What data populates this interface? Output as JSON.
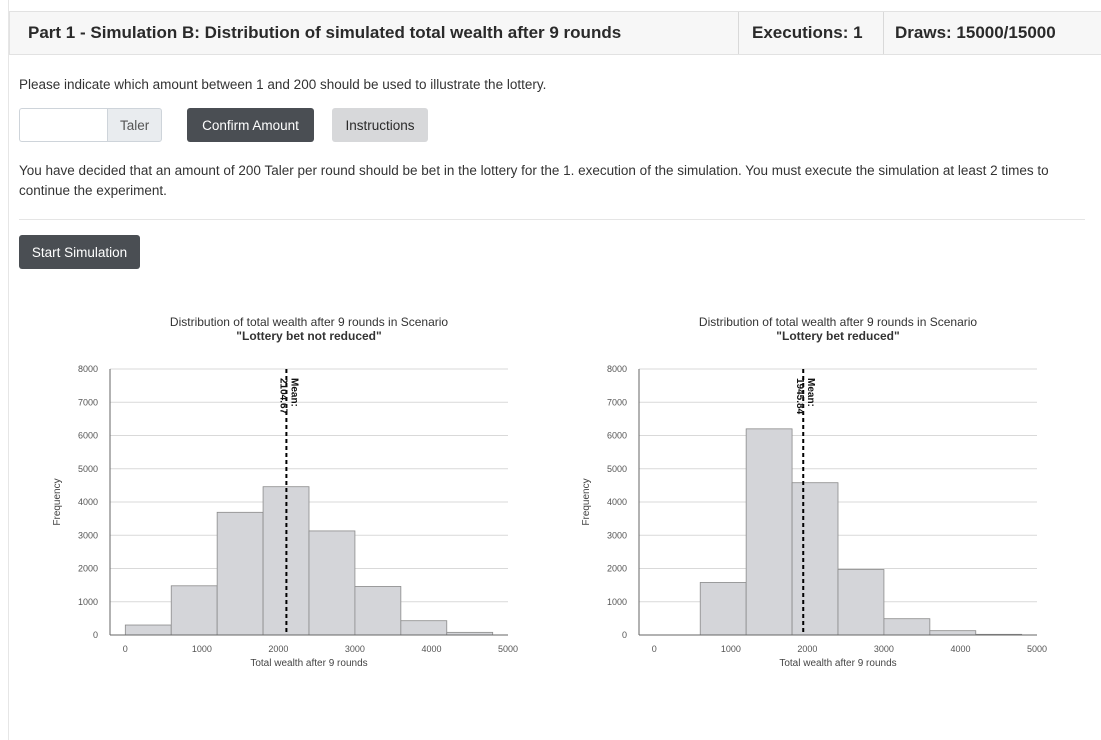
{
  "header": {
    "title": "Part 1 - Simulation B: Distribution of simulated total wealth after 9 rounds",
    "executions": "Executions: 1",
    "draws": "Draws: 15000/15000"
  },
  "form": {
    "prompt": "Please indicate which amount between 1 and 200 should be used to illustrate the lottery.",
    "amount_value": "",
    "amount_unit": "Taler",
    "confirm_label": "Confirm Amount",
    "instructions_label": "Instructions"
  },
  "info_text": "You have decided that an amount of 200 Taler per round should be bet in the lottery for the 1. execution of the simulation. You must execute the simulation at least 2 times to continue the experiment.",
  "start_label": "Start Simulation",
  "colors": {
    "bar_fill": "#d4d5d9",
    "bar_stroke": "#8a8a8a",
    "button_dark": "#4a4e53",
    "button_light": "#d7d8da"
  },
  "chart_data": [
    {
      "type": "bar",
      "title": "Distribution of total wealth after 9 rounds in Scenario",
      "subtitle": "\"Lottery bet not reduced\"",
      "xlabel": "Total wealth after 9 rounds",
      "ylabel": "Frequency",
      "xlim": [
        -200,
        5000
      ],
      "ylim": [
        0,
        8000
      ],
      "xticks": [
        0,
        1000,
        2000,
        3000,
        4000,
        5000
      ],
      "yticks": [
        0,
        1000,
        2000,
        3000,
        4000,
        5000,
        6000,
        7000,
        8000
      ],
      "bins": [
        {
          "x0": 0,
          "x1": 600,
          "count": 300
        },
        {
          "x0": 600,
          "x1": 1200,
          "count": 1480
        },
        {
          "x0": 1200,
          "x1": 1800,
          "count": 3690
        },
        {
          "x0": 1800,
          "x1": 2400,
          "count": 4460
        },
        {
          "x0": 2400,
          "x1": 3000,
          "count": 3130
        },
        {
          "x0": 3000,
          "x1": 3600,
          "count": 1460
        },
        {
          "x0": 3600,
          "x1": 4200,
          "count": 430
        },
        {
          "x0": 4200,
          "x1": 4800,
          "count": 80
        }
      ],
      "mean": 2104.67,
      "mean_label": "Mean:",
      "mean_value_label": "2104.67"
    },
    {
      "type": "bar",
      "title": "Distribution of total wealth after 9 rounds in Scenario",
      "subtitle": "\"Lottery bet reduced\"",
      "xlabel": "Total wealth after 9 rounds",
      "ylabel": "Frequency",
      "xlim": [
        -200,
        5000
      ],
      "ylim": [
        0,
        8000
      ],
      "xticks": [
        0,
        1000,
        2000,
        3000,
        4000,
        5000
      ],
      "yticks": [
        0,
        1000,
        2000,
        3000,
        4000,
        5000,
        6000,
        7000,
        8000
      ],
      "bins": [
        {
          "x0": 0,
          "x1": 600,
          "count": 0
        },
        {
          "x0": 600,
          "x1": 1200,
          "count": 1580
        },
        {
          "x0": 1200,
          "x1": 1800,
          "count": 6200
        },
        {
          "x0": 1800,
          "x1": 2400,
          "count": 4580
        },
        {
          "x0": 2400,
          "x1": 3000,
          "count": 1970
        },
        {
          "x0": 3000,
          "x1": 3600,
          "count": 490
        },
        {
          "x0": 3600,
          "x1": 4200,
          "count": 130
        },
        {
          "x0": 4200,
          "x1": 4800,
          "count": 20
        }
      ],
      "mean": 1945.84,
      "mean_label": "Mean:",
      "mean_value_label": "1945.84"
    }
  ]
}
